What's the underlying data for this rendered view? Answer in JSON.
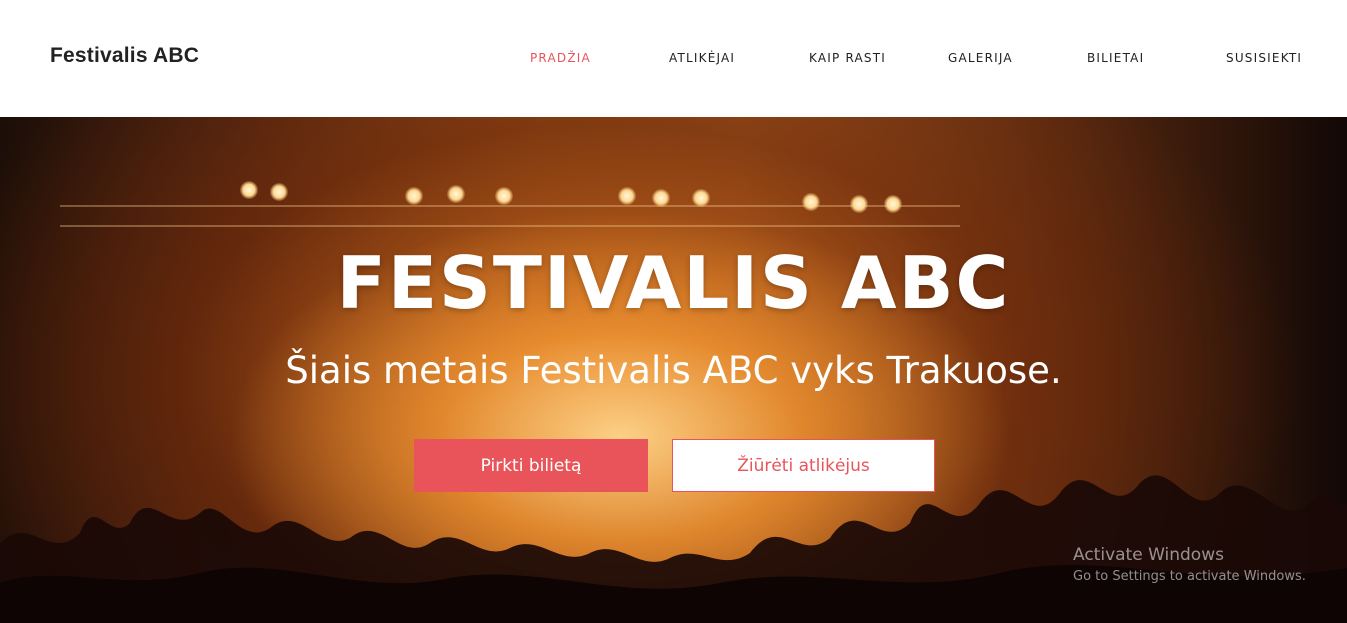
{
  "navbar": {
    "brand": "Festivalis ABC",
    "items": [
      {
        "label": "PRADŽIA",
        "active": true
      },
      {
        "label": "ATLIKĖJAI",
        "active": false
      },
      {
        "label": "KAIP RASTI",
        "active": false
      },
      {
        "label": "GALERIJA",
        "active": false
      },
      {
        "label": "BILIETAI",
        "active": false
      },
      {
        "label": "SUSISIEKTI",
        "active": false
      }
    ]
  },
  "hero": {
    "title": "FESTIVALIS ABC",
    "subtitle": "Šiais metais Festivalis ABC vyks Trakuose.",
    "primary_button": "Pirkti bilietą",
    "secondary_button": "Žiūrėti atlikėjus"
  },
  "watermark": {
    "title": "Activate Windows",
    "subtitle": "Go to Settings to activate Windows."
  },
  "colors": {
    "accent": "#e8545a",
    "nav_text": "#222222",
    "background": "#ffffff"
  }
}
